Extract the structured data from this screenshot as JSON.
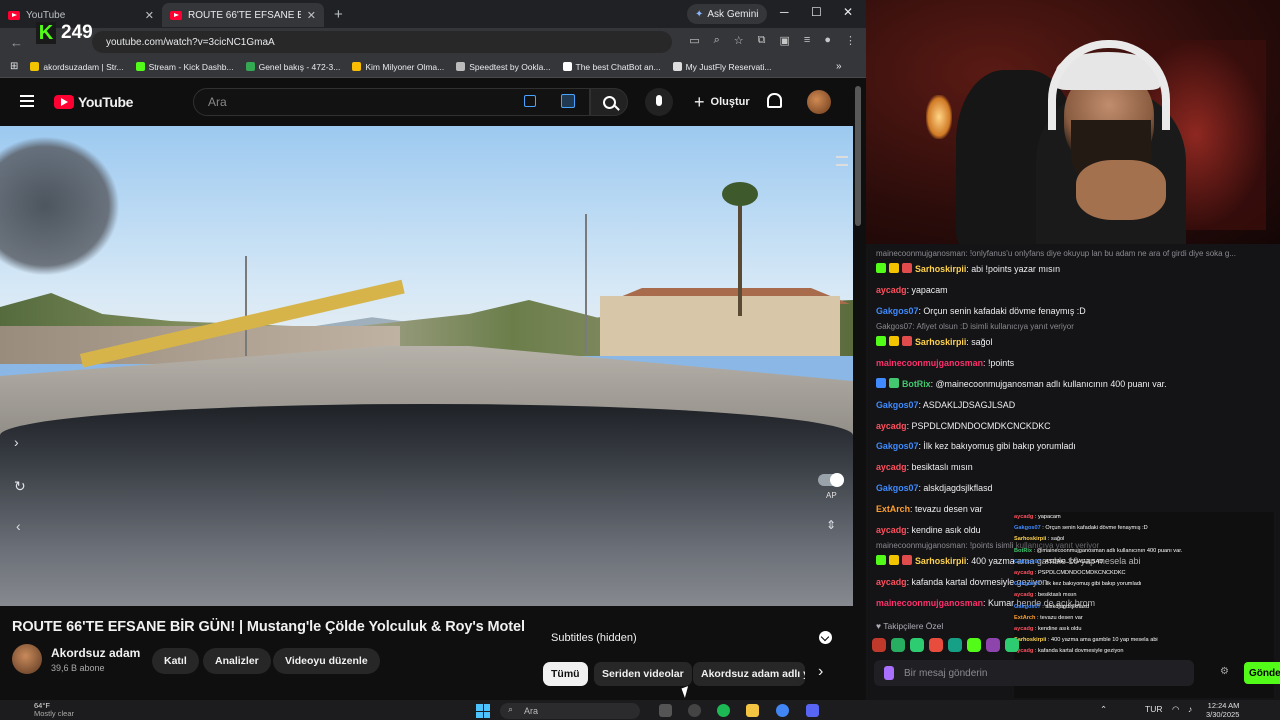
{
  "browser": {
    "tabs": [
      {
        "label": "YouTube",
        "active": false
      },
      {
        "label": "ROUTE 66'TE EFSANE BİR GÜN",
        "active": true
      }
    ],
    "new_tab": "+",
    "ask_gemini": "Ask Gemini",
    "url": "youtube.com/watch?v=3cicNC1GmaA",
    "bookmarks": [
      {
        "label": "akordsuzadam | Str...",
        "color": "#f2c400"
      },
      {
        "label": "Stream - Kick Dashb...",
        "color": "#53fc18"
      },
      {
        "label": "Genel bakış - 472-3...",
        "color": "#34a853"
      },
      {
        "label": "Kim Milyoner Olma...",
        "color": "#fbbc04"
      },
      {
        "label": "Speedtest by Ookla...",
        "color": "#bbbbbb"
      },
      {
        "label": "The best ChatBot an...",
        "color": "#ffffff"
      },
      {
        "label": "My JustFly Reservati...",
        "color": "#dddddd"
      }
    ]
  },
  "kick_overlay": {
    "logo": "K",
    "viewers": "249"
  },
  "youtube": {
    "logo": "YouTube",
    "search_placeholder": "Ara",
    "create_label": "Oluştur",
    "autoplay_label": "AP",
    "video_title": "ROUTE 66'TE EFSANE BİR GÜN! | Mustang'le Çölde Yolculuk & Roy's Motel",
    "channel_name": "Akordsuz adam",
    "channel_subs": "39,6 B abone",
    "buttons": {
      "join": "Katıl",
      "analytics": "Analizler",
      "edit": "Videoyu düzenle"
    },
    "subtitles": "Subtitles (hidden)",
    "chips": [
      "Tümü",
      "Seriden videolar",
      "Akordsuz adam adlı y"
    ]
  },
  "chat": {
    "messages": [
      {
        "type": "reply",
        "text": "mainecoonmujganosman: !onlyfanus'u onlyfans diye okuyup lan bu adam ne ara of girdi diye soka g..."
      },
      {
        "user": "Sarhoskirpii",
        "color": "#ffd34d",
        "badges": [
          "#53fc18",
          "#f2c400",
          "#e04c4c"
        ],
        "text": "abi !points yazar mısın"
      },
      {
        "user": "aycadg",
        "color": "#ff4f5e",
        "badges": [],
        "text": "yapacam"
      },
      {
        "user": "Gakgos07",
        "color": "#3f8bff",
        "badges": [],
        "text": "Orçun senin kafadaki dövme fenaymış :D"
      },
      {
        "type": "reply",
        "text": "Gakgos07: Afiyet olsun :D isimli kullanıcıya yanıt veriyor"
      },
      {
        "user": "Sarhoskirpii",
        "color": "#ffd34d",
        "badges": [
          "#53fc18",
          "#f2c400",
          "#e04c4c"
        ],
        "text": "sağol"
      },
      {
        "user": "mainecoonmujganosman",
        "color": "#ff2f6b",
        "badges": [],
        "text": "!points"
      },
      {
        "user": "BotRix",
        "color": "#43c76f",
        "badges": [
          "#3f8bff",
          "#43c76f"
        ],
        "text": "@mainecoonmujganosman adlı kullanıcının 400 puanı var."
      },
      {
        "user": "Gakgos07",
        "color": "#3f8bff",
        "badges": [],
        "text": "ASDAKLJDSAGJLSAD"
      },
      {
        "user": "aycadg",
        "color": "#ff4f5e",
        "badges": [],
        "text": "PSPDLCMDNDOCMDKCNCKDKC"
      },
      {
        "user": "Gakgos07",
        "color": "#3f8bff",
        "badges": [],
        "text": "İlk kez bakıyomuş gibi bakıp yorumladı"
      },
      {
        "user": "aycadg",
        "color": "#ff4f5e",
        "badges": [],
        "text": "besiktaslı mısın"
      },
      {
        "user": "Gakgos07",
        "color": "#3f8bff",
        "badges": [],
        "text": "alskdjagdsjlkflasd"
      },
      {
        "user": "ExtArch",
        "color": "#ff9f2f",
        "badges": [],
        "text": "tevazu desen var"
      },
      {
        "user": "aycadg",
        "color": "#ff4f5e",
        "badges": [],
        "text": "kendine asık oldu"
      },
      {
        "type": "reply",
        "text": "mainecoonmujganosman: !points isimli kullanıcıya yanıt veriyor"
      },
      {
        "user": "Sarhoskirpii",
        "color": "#ffd34d",
        "badges": [
          "#53fc18",
          "#f2c400",
          "#e04c4c"
        ],
        "text": "400 yazma ama gamble 10 yap mesela abi"
      },
      {
        "user": "aycadg",
        "color": "#ff4f5e",
        "badges": [],
        "text": "kafanda kartal dovmesiyle geziyon"
      },
      {
        "user": "mainecoonmujganosman",
        "color": "#ff2f6b",
        "badges": [],
        "text": "Kumar bende de açık brom"
      }
    ],
    "followers_label": "Takipçilere Özel",
    "input_placeholder": "Bir mesaj gönderin",
    "send_label": "Gönder"
  },
  "mini_overlay": [
    {
      "u": "aycadg",
      "c": "#ff4f5e",
      "t": "yapacam"
    },
    {
      "u": "Gakgos07",
      "c": "#3f8bff",
      "t": "Orçun senin kafadaki dövme fenaymış :D"
    },
    {
      "u": "Sarhoskirpii",
      "c": "#ffd34d",
      "t": "sağol"
    },
    {
      "u": "BotRix",
      "c": "#43c76f",
      "t": "@mainecoonmujganosman adlı kullanıcının 400 puanı var."
    },
    {
      "u": "Gakgos07",
      "c": "#3f8bff",
      "t": "ASDAKLJDSAGJLSAD"
    },
    {
      "u": "aycadg",
      "c": "#ff4f5e",
      "t": "PSPDLCMDNDOCMDKCNCKDKC"
    },
    {
      "u": "Gakgos07",
      "c": "#3f8bff",
      "t": "İlk kez bakıyomuş gibi bakıp yorumladı"
    },
    {
      "u": "aycadg",
      "c": "#ff4f5e",
      "t": "besiktaslı mısın"
    },
    {
      "u": "Gakgos07",
      "c": "#3f8bff",
      "t": "alskdjagdsjlkflasd"
    },
    {
      "u": "ExtArch",
      "c": "#ff9f2f",
      "t": "tevazu desen var"
    },
    {
      "u": "aycadg",
      "c": "#ff4f5e",
      "t": "kendine asık oldu"
    },
    {
      "u": "Sarhoskirpii",
      "c": "#ffd34d",
      "t": "400 yazma ama gamble 10 yap mesela abi"
    },
    {
      "u": "aycadg",
      "c": "#ff4f5e",
      "t": "kafanda kartal dovmesiyle geziyon"
    },
    {
      "u": "mainecoonmujganosman",
      "c": "#ff2f6b",
      "t": "Kumar bende de açık brom"
    }
  ],
  "taskbar": {
    "weather_temp": "64°F",
    "weather_desc": "Mostly clear",
    "search_placeholder": "Ara",
    "language": "TUR",
    "time": "12:24 AM",
    "date": "3/30/2025"
  }
}
